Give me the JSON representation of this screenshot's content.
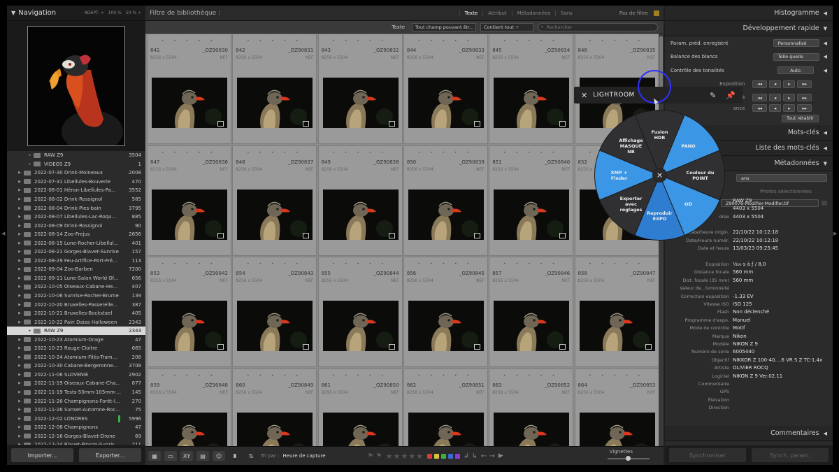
{
  "navigator": {
    "title": "Navigation",
    "zoom_options": [
      "ADAPT. ÷",
      "100 %",
      "50 % ÷"
    ]
  },
  "folders": [
    {
      "name": "RAW Z9",
      "count": "3504",
      "sub": true
    },
    {
      "name": "VIDEOS Z9",
      "count": "1",
      "sub": true
    },
    {
      "name": "2022-07-30 Drink-Moineaux",
      "count": "2008"
    },
    {
      "name": "2022-07-31 Libellules-Bouverie",
      "count": "470"
    },
    {
      "name": "2022-08-01 Héron-Libellules-Pa...",
      "count": "3552"
    },
    {
      "name": "2022-08-02 Drink-Rossignol",
      "count": "585"
    },
    {
      "name": "2022-08-04 Drink-Pies-bain",
      "count": "3795"
    },
    {
      "name": "2022-08-07 Libellules-Lac-Roqu...",
      "count": "885"
    },
    {
      "name": "2022-08-09 Drink-Rossignol",
      "count": "90"
    },
    {
      "name": "2022-08-14 Zoo-Frejus",
      "count": "2656"
    },
    {
      "name": "2022-08-15 Lune-Rocher-Libellul...",
      "count": "401"
    },
    {
      "name": "2022-08-21 Gorges-Blavet-Sunrise",
      "count": "157"
    },
    {
      "name": "2022-08-29 Feu-Artifice-Port-Fré...",
      "count": "113"
    },
    {
      "name": "2022-09-04 Zoo-Barben",
      "count": "7200"
    },
    {
      "name": "2022-09-11 Lune-Salon World Of...",
      "count": "656"
    },
    {
      "name": "2022-10-05 Oiseaux-Cabane-He...",
      "count": "407"
    },
    {
      "name": "2022-10-06 Sunrise-Rocher-Brume",
      "count": "139"
    },
    {
      "name": "2022-10-20 Bruxelles-Passerelle...",
      "count": "387"
    },
    {
      "name": "2022-10-21 Bruxelles-Bockstael",
      "count": "405"
    },
    {
      "name": "2022-10-22 Pairi Daiza Halloween",
      "count": "2343"
    },
    {
      "name": "RAW Z9",
      "count": "2343",
      "sub": true,
      "selected": true
    },
    {
      "name": "2022-10-23 Atomium-Orage",
      "count": "47"
    },
    {
      "name": "2022-10-23 Rouge-Cloitre",
      "count": "665"
    },
    {
      "name": "2022-10-24 Atomium-Filés-Tram...",
      "count": "208"
    },
    {
      "name": "2022-10-30 Cabane-Bergeronne...",
      "count": "3708"
    },
    {
      "name": "2022-11-06 SLOVENIE",
      "count": "2902"
    },
    {
      "name": "2022-11-19 Oiseaux-Cabane-Cha...",
      "count": "877"
    },
    {
      "name": "2022-11-19 Tests-50mm-105mm-...",
      "count": "145"
    },
    {
      "name": "2022-11-26 Champignons-Forêt-l...",
      "count": "270"
    },
    {
      "name": "2022-11-26 Sunset-Automne-Roc...",
      "count": "75"
    },
    {
      "name": "2022-12-02 LONDRES",
      "count": "5996",
      "green": true
    },
    {
      "name": "2022-12-08 Champignons",
      "count": "47"
    },
    {
      "name": "2022-12-16 Gorges-Blavet-Drone",
      "count": "69"
    },
    {
      "name": "2022-12-24 Blavet-Pinson-Sunris...",
      "count": "211"
    }
  ],
  "left_buttons": {
    "import": "Importer...",
    "export": "Exporter..."
  },
  "filter": {
    "title": "Filtre de bibliothèque :",
    "tabs": [
      "Texte",
      "Attribut",
      "Métadonnées",
      "Sans"
    ],
    "no_filter": "Pas de filtre",
    "text_label": "Texte",
    "field_select": "Tout champ pouvant êtr... ÷",
    "rule_select": "Contient tout ÷",
    "search_placeholder": "Rechercher"
  },
  "grid": {
    "dims": "8256 x 5504",
    "ext": "NEF",
    "cells": [
      {
        "num": "841",
        "file": "_OZ90830"
      },
      {
        "num": "842",
        "file": "_OZ90831"
      },
      {
        "num": "843",
        "file": "_OZ90832"
      },
      {
        "num": "844",
        "file": "_OZ90833"
      },
      {
        "num": "845",
        "file": "_OZ90834"
      },
      {
        "num": "846",
        "file": "_OZ90835"
      },
      {
        "num": "847",
        "file": "_OZ90836"
      },
      {
        "num": "848",
        "file": "_OZ90837"
      },
      {
        "num": "849",
        "file": "_OZ90838"
      },
      {
        "num": "850",
        "file": "_OZ90839"
      },
      {
        "num": "851",
        "file": "_OZ90840"
      },
      {
        "num": "852",
        "file": "_OZ90841"
      },
      {
        "num": "853",
        "file": "_OZ90842"
      },
      {
        "num": "854",
        "file": "_OZ90843"
      },
      {
        "num": "855",
        "file": "_OZ90844"
      },
      {
        "num": "856",
        "file": "_OZ90845"
      },
      {
        "num": "857",
        "file": "_OZ90846"
      },
      {
        "num": "858",
        "file": "_OZ90847"
      },
      {
        "num": "859",
        "file": "_OZ90848"
      },
      {
        "num": "860",
        "file": "_OZ90849"
      },
      {
        "num": "861",
        "file": "_OZ90850"
      },
      {
        "num": "862",
        "file": "_OZ90851"
      },
      {
        "num": "863",
        "file": "_OZ90852"
      },
      {
        "num": "864",
        "file": "_OZ90853"
      }
    ]
  },
  "toolbar": {
    "sort_label": "Tri par :",
    "sort_value": "Heure de capture",
    "thumbs_label": "Vignettes",
    "color_labels": [
      "#d63a3a",
      "#d6c23a",
      "#3ab04a",
      "#3a6ad6",
      "#8a3ad6"
    ]
  },
  "right": {
    "histogram": "Histogramme",
    "quick_develop": "Développement rapide",
    "preset_label": "Param. préd. enregistré",
    "preset_value": "Personnalisé",
    "wb_label": "Balance des blancs",
    "wb_value": "Telle quelle",
    "tone_label": "Contrôle des tonalités",
    "auto_label": "Auto",
    "exposure_label": "Exposition",
    "clarity_label": "Clarté",
    "vibrance_label": "ance",
    "reset_label": "Tout rétablir",
    "keywords": "Mots-clés",
    "keyword_list": "Liste des mots-clés",
    "metadata": "Métadonnées",
    "meta_preset": "ans",
    "photos_selected": "Photos sélectionnées",
    "filename": "Z90076-Modifier-Modifier.tif",
    "comments": "Commentaires",
    "sync_label": "Synchroniser",
    "sync_settings": "Synch. param."
  },
  "metadata": [
    {
      "k": "",
      "v": "RAW Z9"
    },
    {
      "k": "",
      "v": "4403 x 5504"
    },
    {
      "k": "drée",
      "v": "4403 x 5504"
    },
    {
      "k": "",
      "v": ""
    },
    {
      "k": "Date/heure origin.",
      "v": "22/10/22 10:12:18"
    },
    {
      "k": "Date/Heure numér.",
      "v": "22/10/22 10:12:18"
    },
    {
      "k": "Date et heure",
      "v": "13/03/23 09:25:45"
    },
    {
      "k": "",
      "v": ""
    },
    {
      "k": "Exposition",
      "v": "¹⁄₂₀₀ s à ƒ / 8,0"
    },
    {
      "k": "Distance focale",
      "v": "560 mm"
    },
    {
      "k": "Dist. focale (35 mm)",
      "v": "560 mm"
    },
    {
      "k": "Valeur de...luminosité",
      "v": ""
    },
    {
      "k": "Correction exposition",
      "v": "-1.33 EV"
    },
    {
      "k": "Vitesse ISO",
      "v": "ISO 125"
    },
    {
      "k": "Flash",
      "v": "Non déclenché"
    },
    {
      "k": "Programme d'expo.",
      "v": "Manuel"
    },
    {
      "k": "Mode de contrôle",
      "v": "Motif"
    },
    {
      "k": "Marque",
      "v": "Nikon"
    },
    {
      "k": "Modèle",
      "v": "NIKON Z 9"
    },
    {
      "k": "Numéro de série",
      "v": "6005440"
    },
    {
      "k": "Objectif",
      "v": "NIKKOR Z 100-40....6 VR S Z TC-1.4x"
    },
    {
      "k": "Artiste",
      "v": "OLIVIER ROCQ"
    },
    {
      "k": "Logiciel",
      "v": "NIKON Z 9 Ver.02.11"
    },
    {
      "k": "Commentaire",
      "v": ""
    },
    {
      "k": "GPS",
      "v": ""
    },
    {
      "k": "Élévation",
      "v": ""
    },
    {
      "k": "Direction",
      "v": ""
    }
  ],
  "popup": {
    "title": "LIGHTROOM",
    "wedges": [
      {
        "label": "Fusion\nHDR",
        "color": "#303033"
      },
      {
        "label": "PANO",
        "color": "#3b97e6"
      },
      {
        "label": "Couleur du\nPOINT",
        "color": "#303033"
      },
      {
        "label": "OD",
        "color": "#3b97e6"
      },
      {
        "label": "Reproduir\nEXPO",
        "color": "#2f7dd0"
      },
      {
        "label": "Exporter\navec\nréglages",
        "color": "#303033"
      },
      {
        "label": "XMP +\nFinder",
        "color": "#3b97e6"
      },
      {
        "label": "Affichage\nMASQUE\nNB",
        "color": "#303033"
      }
    ]
  }
}
